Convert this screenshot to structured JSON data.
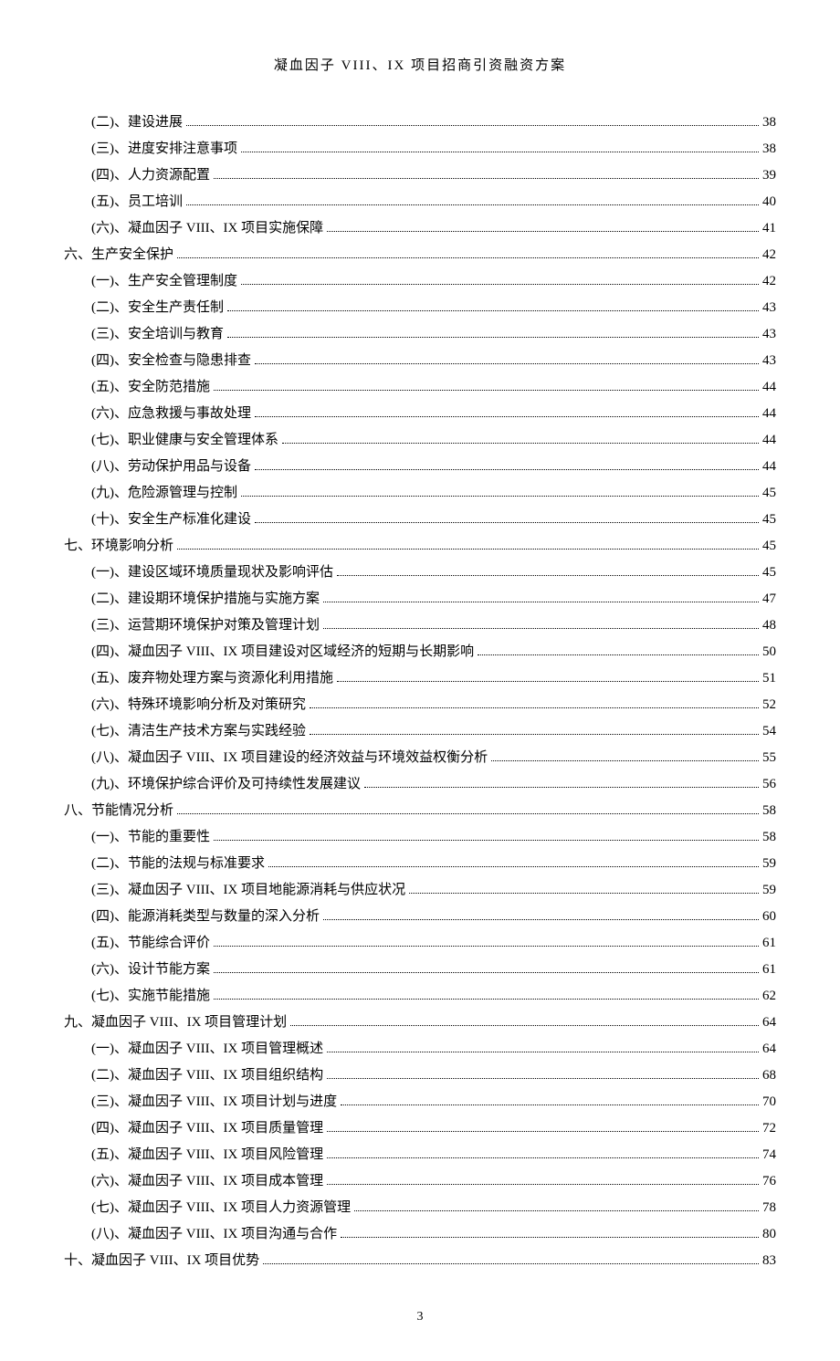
{
  "header_title": "凝血因子 VIII、IX 项目招商引资融资方案",
  "page_number": "3",
  "toc_entries": [
    {
      "level": 2,
      "label": "(二)、建设进展",
      "page": "38"
    },
    {
      "level": 2,
      "label": "(三)、进度安排注意事项",
      "page": "38"
    },
    {
      "level": 2,
      "label": "(四)、人力资源配置",
      "page": "39"
    },
    {
      "level": 2,
      "label": "(五)、员工培训",
      "page": "40"
    },
    {
      "level": 2,
      "label": "(六)、凝血因子 VIII、IX 项目实施保障",
      "page": "41"
    },
    {
      "level": 1,
      "label": "六、生产安全保护",
      "page": "42"
    },
    {
      "level": 2,
      "label": "(一)、生产安全管理制度",
      "page": "42"
    },
    {
      "level": 2,
      "label": "(二)、安全生产责任制",
      "page": "43"
    },
    {
      "level": 2,
      "label": "(三)、安全培训与教育",
      "page": "43"
    },
    {
      "level": 2,
      "label": "(四)、安全检查与隐患排查",
      "page": "43"
    },
    {
      "level": 2,
      "label": "(五)、安全防范措施",
      "page": "44"
    },
    {
      "level": 2,
      "label": "(六)、应急救援与事故处理",
      "page": "44"
    },
    {
      "level": 2,
      "label": "(七)、职业健康与安全管理体系",
      "page": "44"
    },
    {
      "level": 2,
      "label": "(八)、劳动保护用品与设备",
      "page": "44"
    },
    {
      "level": 2,
      "label": "(九)、危险源管理与控制",
      "page": "45"
    },
    {
      "level": 2,
      "label": "(十)、安全生产标准化建设",
      "page": "45"
    },
    {
      "level": 1,
      "label": "七、环境影响分析",
      "page": "45"
    },
    {
      "level": 2,
      "label": "(一)、建设区域环境质量现状及影响评估",
      "page": "45"
    },
    {
      "level": 2,
      "label": "(二)、建设期环境保护措施与实施方案",
      "page": "47"
    },
    {
      "level": 2,
      "label": "(三)、运营期环境保护对策及管理计划",
      "page": "48"
    },
    {
      "level": 2,
      "label": "(四)、凝血因子 VIII、IX 项目建设对区域经济的短期与长期影响",
      "page": "50"
    },
    {
      "level": 2,
      "label": "(五)、废弃物处理方案与资源化利用措施",
      "page": "51"
    },
    {
      "level": 2,
      "label": "(六)、特殊环境影响分析及对策研究",
      "page": "52"
    },
    {
      "level": 2,
      "label": "(七)、清洁生产技术方案与实践经验",
      "page": "54"
    },
    {
      "level": 2,
      "label": "(八)、凝血因子 VIII、IX 项目建设的经济效益与环境效益权衡分析",
      "page": "55"
    },
    {
      "level": 2,
      "label": "(九)、环境保护综合评价及可持续性发展建议",
      "page": "56"
    },
    {
      "level": 1,
      "label": "八、节能情况分析",
      "page": "58"
    },
    {
      "level": 2,
      "label": "(一)、节能的重要性",
      "page": "58"
    },
    {
      "level": 2,
      "label": "(二)、节能的法规与标准要求",
      "page": "59"
    },
    {
      "level": 2,
      "label": "(三)、凝血因子 VIII、IX 项目地能源消耗与供应状况",
      "page": "59"
    },
    {
      "level": 2,
      "label": "(四)、能源消耗类型与数量的深入分析",
      "page": "60"
    },
    {
      "level": 2,
      "label": "(五)、节能综合评价",
      "page": "61"
    },
    {
      "level": 2,
      "label": "(六)、设计节能方案",
      "page": "61"
    },
    {
      "level": 2,
      "label": "(七)、实施节能措施",
      "page": "62"
    },
    {
      "level": 1,
      "label": "九、凝血因子 VIII、IX 项目管理计划",
      "page": "64"
    },
    {
      "level": 2,
      "label": "(一)、凝血因子 VIII、IX 项目管理概述",
      "page": "64"
    },
    {
      "level": 2,
      "label": "(二)、凝血因子 VIII、IX 项目组织结构",
      "page": "68"
    },
    {
      "level": 2,
      "label": "(三)、凝血因子 VIII、IX 项目计划与进度",
      "page": "70"
    },
    {
      "level": 2,
      "label": "(四)、凝血因子 VIII、IX 项目质量管理",
      "page": "72"
    },
    {
      "level": 2,
      "label": "(五)、凝血因子 VIII、IX 项目风险管理",
      "page": "74"
    },
    {
      "level": 2,
      "label": "(六)、凝血因子 VIII、IX 项目成本管理",
      "page": "76"
    },
    {
      "level": 2,
      "label": "(七)、凝血因子 VIII、IX 项目人力资源管理",
      "page": "78"
    },
    {
      "level": 2,
      "label": "(八)、凝血因子 VIII、IX 项目沟通与合作",
      "page": "80"
    },
    {
      "level": 1,
      "label": "十、凝血因子 VIII、IX 项目优势",
      "page": "83"
    }
  ]
}
